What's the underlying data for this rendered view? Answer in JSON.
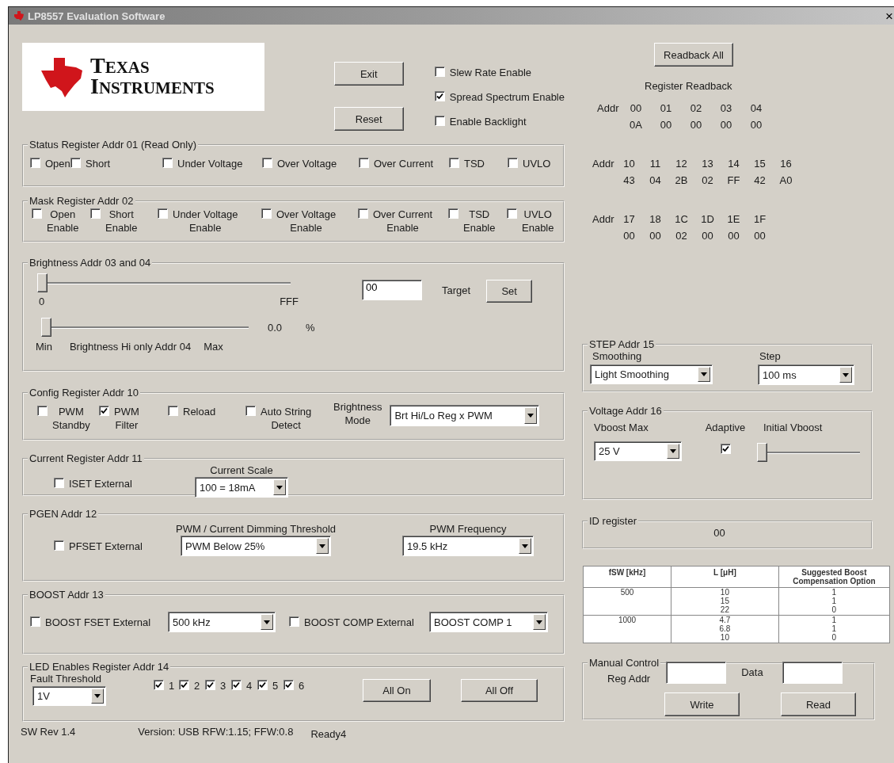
{
  "window": {
    "title": "LP8557 Evaluation Software",
    "close": "×"
  },
  "logo": {
    "line1": "TEXAS",
    "line2": "INSTRUMENTS"
  },
  "top_buttons": [
    "Exit",
    "Reset"
  ],
  "options": [
    {
      "label": "Slew Rate Enable",
      "checked": false
    },
    {
      "label": "Spread Spectrum Enable",
      "checked": true
    },
    {
      "label": "Enable Backlight",
      "checked": false
    }
  ],
  "status": {
    "title": "Status Register Addr 01 (Read Only)",
    "items": [
      {
        "label": "Open",
        "checked": false
      },
      {
        "label": "Short",
        "checked": false
      },
      {
        "label": "Under Voltage",
        "checked": false
      },
      {
        "label": "Over Voltage",
        "checked": false
      },
      {
        "label": "Over Current",
        "checked": false
      },
      {
        "label": "TSD",
        "checked": false
      },
      {
        "label": "UVLO",
        "checked": false
      }
    ]
  },
  "mask": {
    "title": "Mask Register Addr 02",
    "items": [
      {
        "lines": [
          "Open",
          "Enable"
        ],
        "checked": false
      },
      {
        "lines": [
          "Short",
          "Enable"
        ],
        "checked": false
      },
      {
        "lines": [
          "Under Voltage",
          "Enable"
        ],
        "checked": false
      },
      {
        "lines": [
          "Over Voltage",
          "Enable"
        ],
        "checked": false
      },
      {
        "lines": [
          "Over Current",
          "Enable"
        ],
        "checked": false
      },
      {
        "lines": [
          "TSD",
          "Enable"
        ],
        "checked": false
      },
      {
        "lines": [
          "UVLO",
          "Enable"
        ],
        "checked": false
      }
    ]
  },
  "brightness": {
    "title": "Brightness Addr 03 and 04",
    "main_slider": {
      "level": 0,
      "min_label": "0",
      "max_label": "FFF"
    },
    "target_value": "00",
    "target_label": "Target",
    "set_button": "Set",
    "hi_slider": {
      "level": 0,
      "min_label": "Min",
      "caption": "Brightness Hi only Addr 04",
      "max_label": "Max"
    },
    "reading": "0.0",
    "unit": "%"
  },
  "config": {
    "title": "Config Register Addr 10",
    "items": [
      {
        "lines": [
          "PWM",
          "Standby"
        ],
        "checked": false
      },
      {
        "lines": [
          "PWM",
          "Filter"
        ],
        "checked": true
      },
      {
        "lines": [
          "Reload"
        ],
        "checked": false
      },
      {
        "lines": [
          "Auto String",
          "Detect"
        ],
        "checked": false
      }
    ],
    "mode_label": [
      "Brightness",
      "Mode"
    ],
    "mode_value": "Brt Hi/Lo Reg x PWM"
  },
  "current": {
    "title": "Current Register Addr 11",
    "iset": {
      "label": "ISET External",
      "checked": false
    },
    "scale_label": "Current Scale",
    "scale_value": "100 = 18mA"
  },
  "pgen": {
    "title": "PGEN Addr 12",
    "pfset": {
      "label": "PFSET External",
      "checked": false
    },
    "threshold_label": "PWM / Current Dimming Threshold",
    "threshold_value": "PWM Below 25%",
    "frequency_label": "PWM Frequency",
    "frequency_value": "19.5 kHz"
  },
  "boost": {
    "title": "BOOST Addr 13",
    "fset": {
      "label": "BOOST FSET External",
      "checked": false
    },
    "fset_value": "500 kHz",
    "comp": {
      "label": "BOOST COMP External",
      "checked": false
    },
    "comp_value": "BOOST COMP 1"
  },
  "led": {
    "title": "LED Enables Register Addr 14",
    "fault_label": "Fault Threshold",
    "fault_value": "1V",
    "strings": [
      {
        "label": "1",
        "checked": true
      },
      {
        "label": "2",
        "checked": true
      },
      {
        "label": "3",
        "checked": true
      },
      {
        "label": "4",
        "checked": true
      },
      {
        "label": "5",
        "checked": true
      },
      {
        "label": "6",
        "checked": true
      }
    ],
    "buttons": [
      "All On",
      "All Off"
    ]
  },
  "footer": {
    "sw_rev": "SW Rev 1.4",
    "version": "Version: USB RFW:1.15; FFW:0.8",
    "status": "Ready4"
  },
  "readback": {
    "button": "Readback All",
    "title": "Register Readback",
    "groups": [
      {
        "label": "Addr",
        "addrs": [
          "00",
          "01",
          "02",
          "03",
          "04"
        ],
        "values": [
          "0A",
          "00",
          "00",
          "00",
          "00"
        ]
      },
      {
        "label": "Addr",
        "addrs": [
          "10",
          "11",
          "12",
          "13",
          "14",
          "15",
          "16"
        ],
        "values": [
          "43",
          "04",
          "2B",
          "02",
          "FF",
          "42",
          "A0"
        ]
      },
      {
        "label": "Addr",
        "addrs": [
          "17",
          "18",
          "1C",
          "1D",
          "1E",
          "1F"
        ],
        "values": [
          "00",
          "00",
          "02",
          "00",
          "00",
          "00"
        ]
      }
    ]
  },
  "step": {
    "title": "STEP Addr 15",
    "smoothing_label": "Smoothing",
    "smoothing_value": "Light Smoothing",
    "step_label": "Step",
    "step_value": "100 ms"
  },
  "voltage": {
    "title": "Voltage Addr 16",
    "vboost_label": "Vboost Max",
    "vboost_value": "25 V",
    "adaptive_label": "Adaptive",
    "adaptive_checked": true,
    "initial_label": "Initial Vboost",
    "initial_slider": {
      "level": 0
    }
  },
  "id_register": {
    "title": "ID register",
    "value": "00"
  },
  "boost_table": {
    "columns": [
      "fSW [kHz]",
      "L [μH]",
      "Suggested Boost Compensation Option"
    ],
    "rows": [
      {
        "fsw": "500",
        "inductance": [
          "10",
          "15",
          "22"
        ],
        "option": [
          "1",
          "1",
          "0"
        ]
      },
      {
        "fsw": "1000",
        "inductance": [
          "4.7",
          "6.8",
          "10"
        ],
        "option": [
          "1",
          "1",
          "0"
        ]
      }
    ]
  },
  "manual": {
    "title": "Manual Control",
    "reg_label": "Reg Addr",
    "data_label": "Data",
    "buttons": [
      "Write",
      "Read"
    ]
  }
}
